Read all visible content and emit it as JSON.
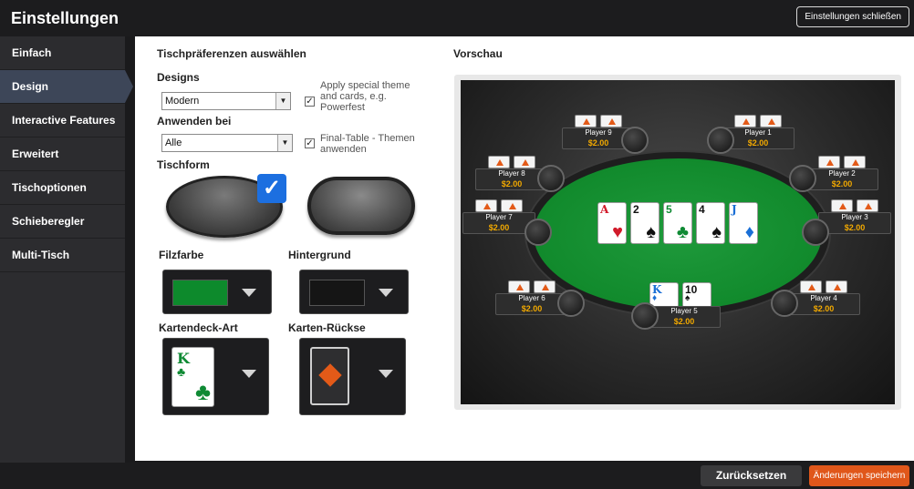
{
  "window": {
    "title": "Einstellungen",
    "close_label": "Einstellungen schließen"
  },
  "sidebar": {
    "items": [
      {
        "label": "Einfach"
      },
      {
        "label": "Design"
      },
      {
        "label": "Interactive Features"
      },
      {
        "label": "Erweitert"
      },
      {
        "label": "Tischoptionen"
      },
      {
        "label": "Schieberegler"
      },
      {
        "label": "Multi-Tisch"
      }
    ],
    "active": "Design"
  },
  "prefs": {
    "heading": "Tischpräferenzen auswählen",
    "designs_label": "Designs",
    "designs_value": "Modern",
    "apply_theme_label": "Apply special theme and cards, e.g. Powerfest",
    "apply_theme_checked": true,
    "apply_at_label": "Anwenden bei",
    "apply_at_value": "Alle",
    "final_table_label": "Final-Table - Themen anwenden",
    "final_table_checked": true,
    "table_shape_label": "Tischform",
    "table_shape_selected": "oval",
    "felt_color_label": "Filzfarbe",
    "felt_color": "#0d8a2c",
    "background_label": "Hintergrund",
    "card_deck_label": "Kartendeck-Art",
    "card_deck_rank": "K",
    "card_deck_suit": "♣",
    "card_back_label": "Karten-Rückse"
  },
  "preview": {
    "heading": "Vorschau",
    "community_cards": [
      {
        "rank": "A",
        "suit": "♥",
        "color": "#d11a2a"
      },
      {
        "rank": "2",
        "suit": "♠",
        "color": "#111111"
      },
      {
        "rank": "5",
        "suit": "♣",
        "color": "#0f8a34"
      },
      {
        "rank": "4",
        "suit": "♠",
        "color": "#111111"
      },
      {
        "rank": "J",
        "suit": "♦",
        "color": "#1a6fd6"
      }
    ],
    "hero_cards": [
      {
        "rank": "K",
        "suit": "♦",
        "color": "#1a6fd6"
      },
      {
        "rank": "10",
        "suit": "♠",
        "color": "#111111"
      }
    ],
    "players": [
      {
        "name": "Player 1",
        "chips": "$2.00"
      },
      {
        "name": "Player 2",
        "chips": "$2.00"
      },
      {
        "name": "Player 3",
        "chips": "$2.00"
      },
      {
        "name": "Player 4",
        "chips": "$2.00"
      },
      {
        "name": "Player 5",
        "chips": "$2.00"
      },
      {
        "name": "Player 6",
        "chips": "$2.00"
      },
      {
        "name": "Player 7",
        "chips": "$2.00"
      },
      {
        "name": "Player 8",
        "chips": "$2.00"
      },
      {
        "name": "Player 9",
        "chips": "$2.00"
      }
    ]
  },
  "footer": {
    "reset_label": "Zurücksetzen",
    "save_label": "Änderungen speichern"
  },
  "colors": {
    "accent_orange": "#e0571a",
    "active_nav": "#3d4658",
    "selected_blue": "#1c6fe0"
  }
}
